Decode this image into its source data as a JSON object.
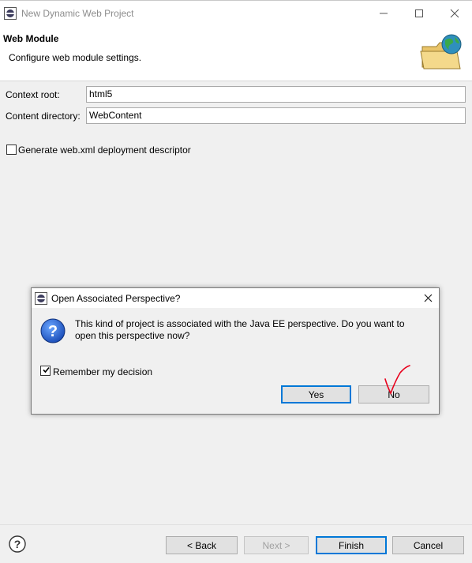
{
  "window": {
    "title": "New Dynamic Web Project",
    "minimize_icon": "minimize-icon",
    "maximize_icon": "maximize-icon",
    "close_icon": "close-icon"
  },
  "header": {
    "title": "Web Module",
    "subtitle": "Configure web module settings.",
    "banner_icon": "folder-globe-icon"
  },
  "form": {
    "context_root_label": "Context root:",
    "context_root_value": "html5",
    "content_dir_label": "Content directory:",
    "content_dir_value": "WebContent",
    "generate_label": "Generate web.xml deployment descriptor",
    "generate_checked": false
  },
  "dialog": {
    "title": "Open Associated Perspective?",
    "message_line1": "This kind of project is associated with the Java EE perspective.  Do you want to",
    "message_line2": "open this perspective now?",
    "remember_label": "Remember my decision",
    "remember_checked": true,
    "yes_label": "Yes",
    "no_label": "No",
    "question_icon": "question-icon"
  },
  "footer": {
    "back_label": "< Back",
    "next_label": "Next >",
    "finish_label": "Finish",
    "cancel_label": "Cancel",
    "help_icon": "help-icon"
  },
  "colors": {
    "accent": "#0078d7",
    "annotation": "#e8001c"
  }
}
